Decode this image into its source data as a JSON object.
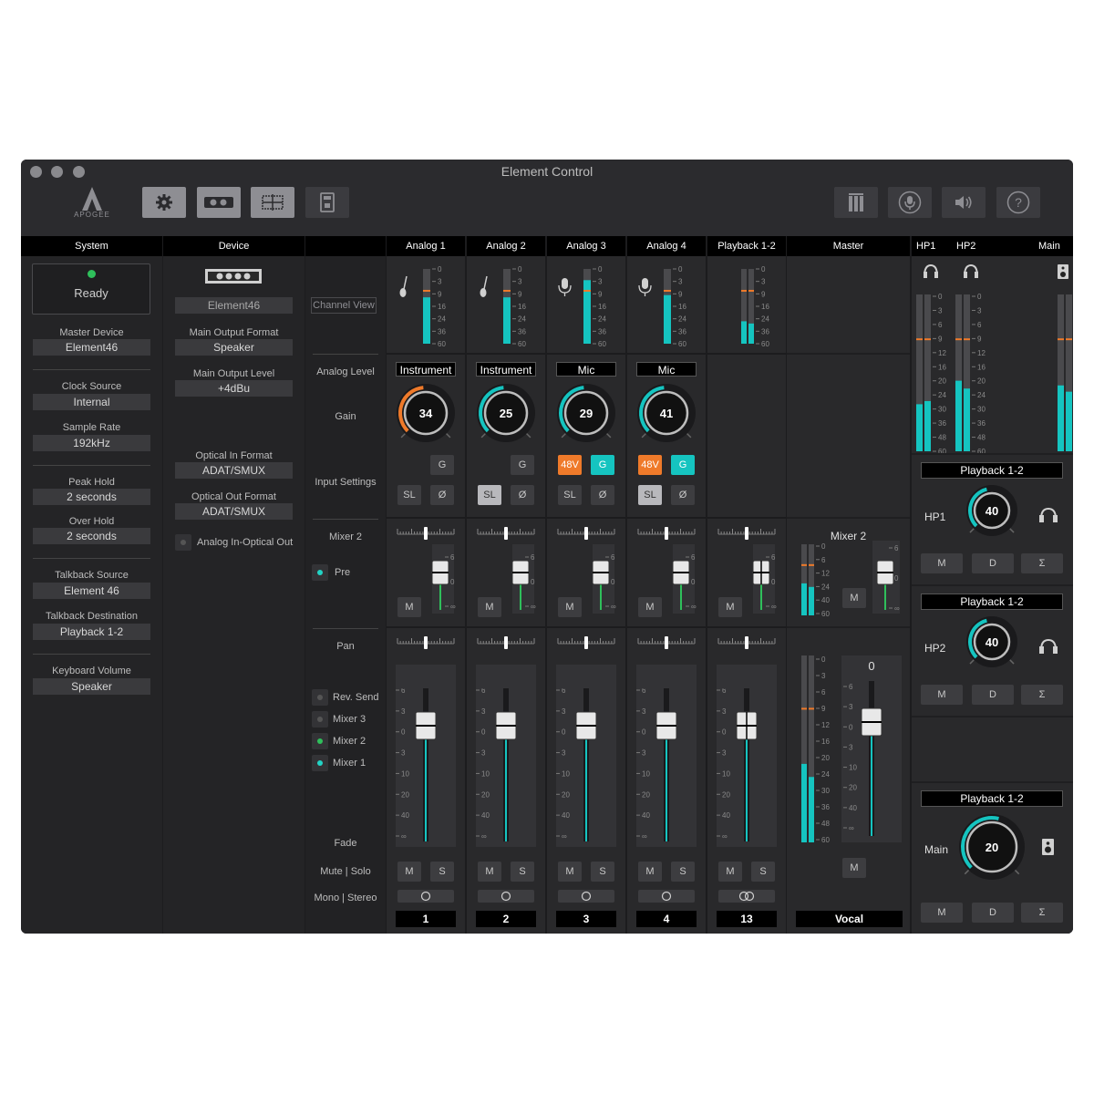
{
  "window": {
    "title": "Element Control"
  },
  "brand": {
    "name": "APOGEE"
  },
  "toolbar": {
    "left_icons": [
      "gear-icon",
      "device-icon",
      "mixer-view-icon",
      "remote-icon"
    ],
    "right_icons": [
      "meters-icon",
      "mic-icon",
      "speaker-icon",
      "help-icon"
    ]
  },
  "columns": {
    "system": "System",
    "device": "Device",
    "master": "Master",
    "hp1": "HP1",
    "hp2": "HP2",
    "main": "Main"
  },
  "system": {
    "status": "Ready",
    "master_device_label": "Master Device",
    "master_device": "Element46",
    "clock_source_label": "Clock Source",
    "clock_source": "Internal",
    "sample_rate_label": "Sample Rate",
    "sample_rate": "192kHz",
    "peak_hold_label": "Peak Hold",
    "peak_hold": "2 seconds",
    "over_hold_label": "Over Hold",
    "over_hold": "2 seconds",
    "talkback_source_label": "Talkback Source",
    "talkback_source": "Element 46",
    "talkback_dest_label": "Talkback Destination",
    "talkback_dest": "Playback 1-2",
    "keyboard_volume_label": "Keyboard Volume",
    "keyboard_volume": "Speaker"
  },
  "device": {
    "name": "Element46",
    "main_output_format_label": "Main Output Format",
    "main_output_format": "Speaker",
    "main_output_level_label": "Main Output Level",
    "main_output_level": "+4dBu",
    "optical_in_label": "Optical In Format",
    "optical_in": "ADAT/SMUX",
    "optical_out_label": "Optical Out Format",
    "optical_out": "ADAT/SMUX",
    "analog_optical_out": "Analog In-Optical Out"
  },
  "rowlabels": {
    "channel_view": "Channel View",
    "analog_level": "Analog Level",
    "gain": "Gain",
    "input_settings": "Input Settings",
    "mixer2": "Mixer 2",
    "pre": "Pre",
    "pan": "Pan",
    "rev_send": "Rev. Send",
    "mixer3": "Mixer 3",
    "mixer2b": "Mixer 2",
    "mixer1": "Mixer 1",
    "fade": "Fade",
    "mute_solo": "Mute | Solo",
    "mono_stereo": "Mono | Stereo"
  },
  "buttons": {
    "g": "G",
    "sl": "SL",
    "phase": "Ø",
    "v48": "48V",
    "m": "M",
    "s": "S",
    "d": "D",
    "sigma": "Σ"
  },
  "meter_scale": [
    "0",
    "3",
    "9",
    "16",
    "24",
    "36",
    "60"
  ],
  "fader_scale": [
    "6",
    "3",
    "0",
    "3",
    "10",
    "20",
    "40",
    "∞"
  ],
  "big_meter_scale": [
    "0",
    "3",
    "6",
    "9",
    "12",
    "16",
    "20",
    "24",
    "30",
    "36",
    "48",
    "60"
  ],
  "small_fader_scale": [
    "6",
    "0",
    "∞"
  ],
  "mixer_scale": [
    "0",
    "6",
    "12",
    "24",
    "40",
    "60"
  ],
  "channels": [
    {
      "name": "Analog 1",
      "level": "Instrument",
      "gain": "34",
      "pan": "0",
      "number": "1",
      "icon": "guitar-icon",
      "meter": 0.62
    },
    {
      "name": "Analog 2",
      "level": "Instrument",
      "gain": "25",
      "pan": "0",
      "number": "2",
      "icon": "guitar-icon",
      "meter": 0.62
    },
    {
      "name": "Analog 3",
      "level": "Mic",
      "gain": "29",
      "pan": "0",
      "number": "3",
      "icon": "mic-icon",
      "meter": 0.85
    },
    {
      "name": "Analog 4",
      "level": "Mic",
      "gain": "41",
      "pan": "0",
      "number": "4",
      "icon": "mic-icon",
      "meter": 0.65
    },
    {
      "name": "Playback 1-2",
      "level": "",
      "gain": "",
      "pan": "0",
      "number": "13",
      "icon": "",
      "meter": 0.3
    }
  ],
  "master": {
    "mixer_label": "Mixer 2",
    "fader_value": "0",
    "name": "Vocal"
  },
  "outputs": [
    {
      "source": "Playback 1-2",
      "label": "HP1",
      "value": "40",
      "icon": "headphones-icon"
    },
    {
      "source": "Playback 1-2",
      "label": "HP2",
      "value": "40",
      "icon": "headphones-icon"
    },
    {
      "source": "Playback 1-2",
      "label": "Main",
      "value": "20",
      "icon": "speaker-icon"
    }
  ],
  "colors": {
    "accent": "#15c4c0",
    "orange": "#ef7a2a",
    "green": "#2fbf5b"
  }
}
